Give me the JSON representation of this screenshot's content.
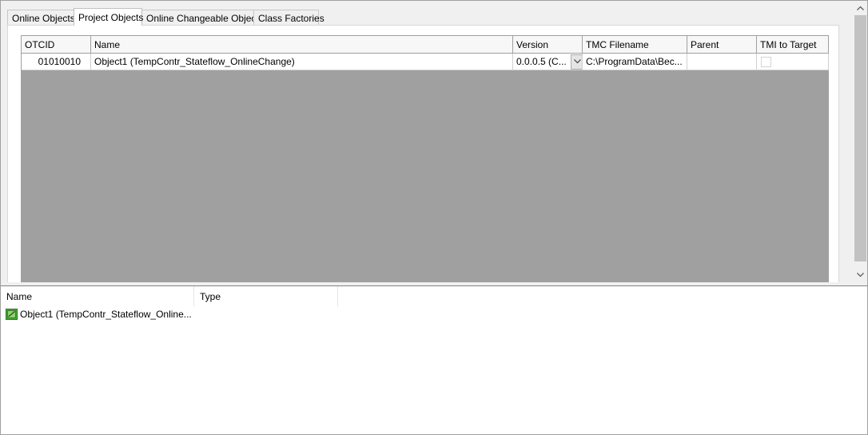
{
  "tabs": [
    {
      "label": "Online Objects"
    },
    {
      "label": "Project Objects"
    },
    {
      "label": "Online Changeable Objects"
    },
    {
      "label": "Class Factories"
    }
  ],
  "grid": {
    "columns": [
      "OTCID",
      "Name",
      "Version",
      "TMC Filename",
      "Parent",
      "TMI to Target"
    ],
    "rows": [
      {
        "otcid": "01010010",
        "name": "Object1 (TempContr_Stateflow_OnlineChange)",
        "version": "0.0.0.5 (C...",
        "tmc_filename": "C:\\ProgramData\\Bec...",
        "parent": "",
        "tmi_to_target": false
      }
    ]
  },
  "lower": {
    "columns": [
      "Name",
      "Type"
    ],
    "items": [
      {
        "name": "Object1 (TempContr_Stateflow_Online...",
        "type": ""
      }
    ]
  },
  "colors": {
    "grid_background": "#a0a0a0",
    "icon_green": "#3f9c35"
  }
}
